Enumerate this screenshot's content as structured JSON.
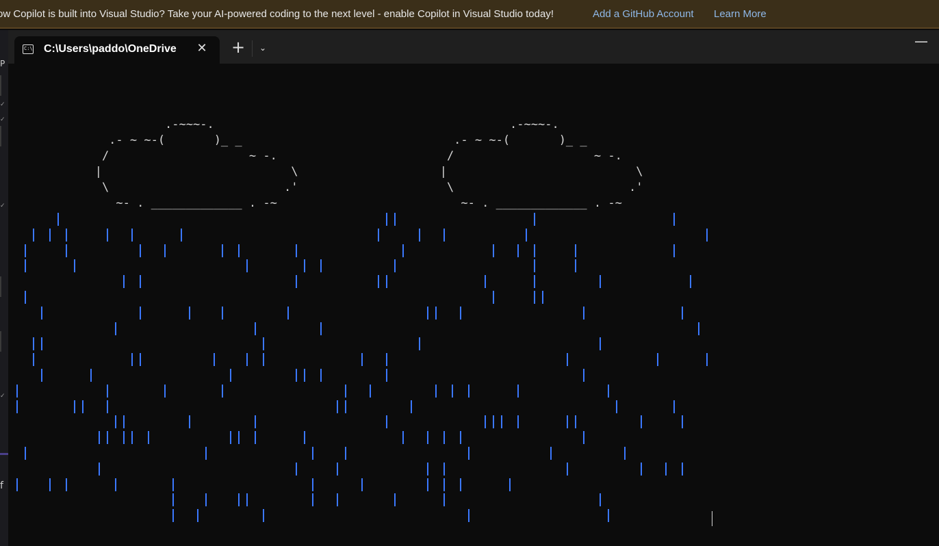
{
  "banner": {
    "message": "ow Copilot is built into Visual Studio? Take your AI-powered coding to the next level - enable Copilot in Visual Studio today!",
    "link_github": "Add a GitHub Account",
    "link_learn": "Learn More"
  },
  "tab": {
    "title": "C:\\Users\\paddo\\OneDrive",
    "close_glyph": "✕"
  },
  "toolbar": {
    "new_tab_glyph": "+",
    "dropdown_glyph": "⌄",
    "minimize_glyph": "—"
  },
  "terminal": {
    "cloud_left": "             .-~~~-.\n     .- ~ ~-(       )_ _\n    /                    ~ -.\n   |                           \\\n    \\                         .'\n      ~- . _____________ . -~",
    "cloud_right": "             .-~~~-.\n     .- ~ ~-(       )_ _\n    /                    ~ -.\n   |                           \\\n    \\                         .'\n      ~- . _____________ . -~",
    "rain_char": "|",
    "rain_color": "#3b78ff",
    "text_color": "#d6d6d6",
    "background": "#0c0c0c"
  },
  "vs_edge": {
    "marks": [
      "P",
      "✓",
      "✓",
      "✓",
      "✓",
      "f"
    ]
  }
}
